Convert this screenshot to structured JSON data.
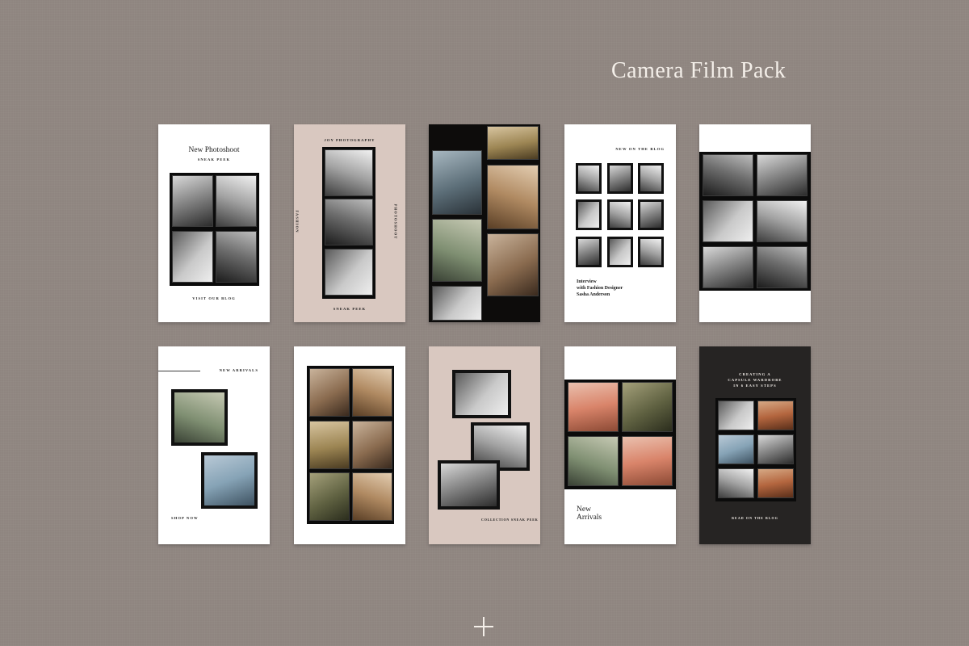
{
  "title": "Camera Film Pack",
  "cards": {
    "c1": {
      "title": "New Photoshoot",
      "subtitle": "SNEAK PEEK",
      "footer": "VISIT OUR BLOG"
    },
    "c2": {
      "top": "JOY PHOTOGRAPHY",
      "left": "FASHION",
      "right": "PHOTOSHOOT",
      "footer": "SNEAK PEEK"
    },
    "c4": {
      "top": "NEW ON THE BLOG",
      "body1": "Interview",
      "body2": "with Fashion Designer",
      "body3": "Sasha Anderson"
    },
    "c6": {
      "top": "NEW ARRIVALS",
      "footer": "SHOP NOW"
    },
    "c8": {
      "footer": "COLLECTION SNEAK PEEK"
    },
    "c9": {
      "title1": "New",
      "title2": "Arrivals"
    },
    "c10": {
      "line1": "CREATING A",
      "line2": "CAPSULE WARDROBE",
      "line3": "IN 6 EASY STEPS",
      "footer": "READ ON THE BLOG"
    }
  },
  "icons": {
    "plus": "plus-icon"
  },
  "colors": {
    "background": "#8f8580",
    "pink_card": "#d9c8c0",
    "dark_card": "#262423",
    "title": "#f4efe9"
  }
}
